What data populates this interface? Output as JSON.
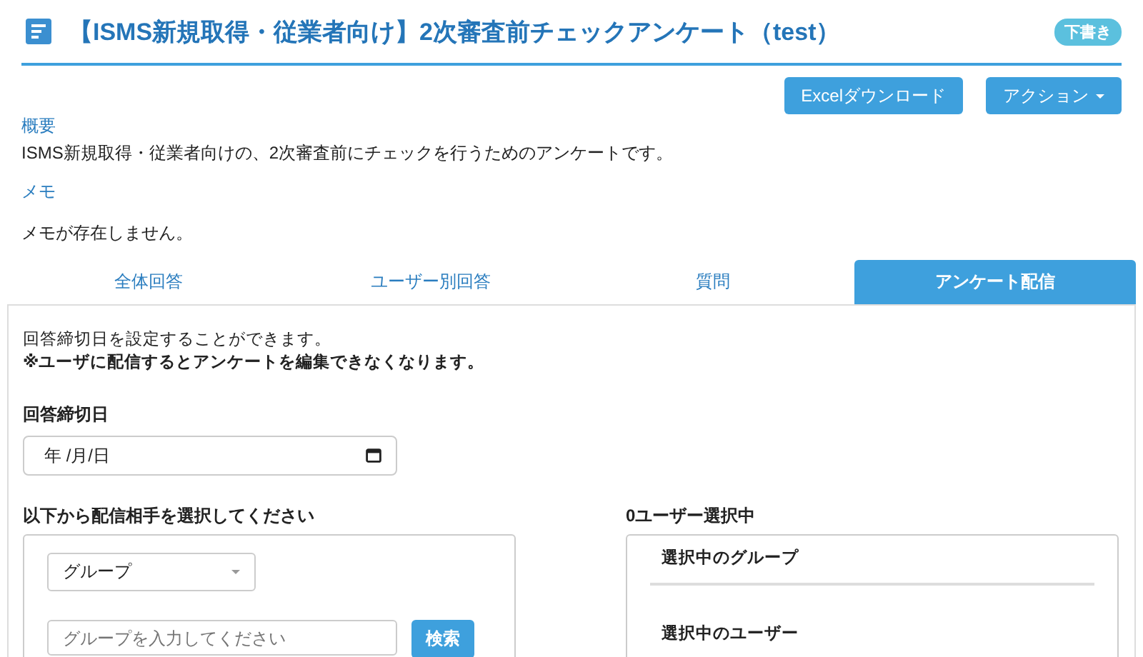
{
  "header": {
    "title": "【ISMS新規取得・従業者向け】2次審査前チェックアンケート（test）",
    "status_badge": "下書き"
  },
  "actions": [
    {
      "label": "Excelダウンロード",
      "kind": "button"
    },
    {
      "label": "アクション",
      "kind": "dropdown"
    }
  ],
  "summary": {
    "label": "概要",
    "text": "ISMS新規取得・従業者向けの、2次審査前にチェックを行うためのアンケートです。"
  },
  "memo": {
    "label": "メモ",
    "text": "メモが存在しません。"
  },
  "tabs": [
    {
      "label": "全体回答",
      "selected": false
    },
    {
      "label": "ユーザー別回答",
      "selected": false
    },
    {
      "label": "質問",
      "selected": false
    },
    {
      "label": "アンケート配信",
      "selected": true
    }
  ],
  "distribution": {
    "intro": "回答締切日を設定することができます。",
    "warning": "※ユーザに配信するとアンケートを編集できなくなります。",
    "deadline": {
      "label": "回答締切日",
      "value": "年 /月/日"
    },
    "recipients": {
      "title": "以下から配信相手を選択してください",
      "type_select": "グループ",
      "search": {
        "placeholder": "グループを入力してください",
        "button": "検索"
      }
    },
    "selection": {
      "title": "0ユーザー選択中",
      "groups_heading": "選択中のグループ",
      "users_heading": "選択中のユーザー"
    }
  }
}
